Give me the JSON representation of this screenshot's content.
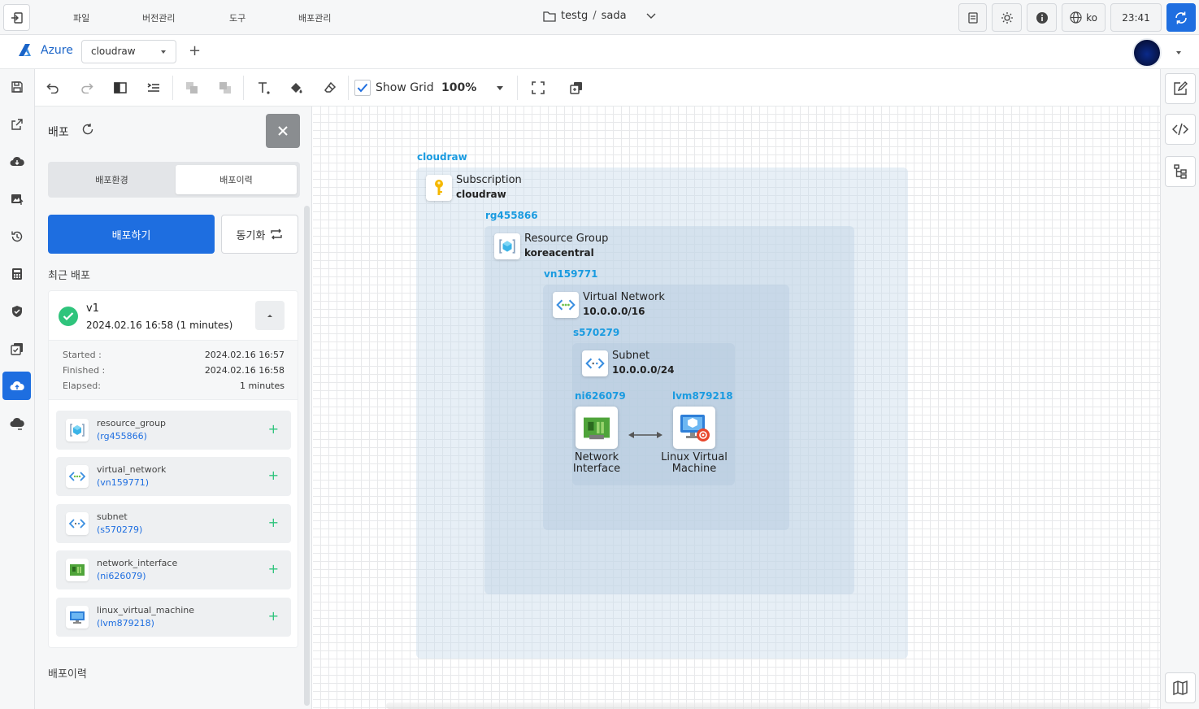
{
  "menu": {
    "items": [
      "파일",
      "버전관리",
      "도구",
      "배포관리"
    ]
  },
  "project": {
    "workspace": "testg",
    "separator": "/",
    "name": "sada"
  },
  "topbar": {
    "language": "ko",
    "time": "23:41"
  },
  "bar2": {
    "brand": "Azure",
    "environment": "cloudraw",
    "add_label": "+"
  },
  "toolbar": {
    "show_grid_label": "Show Grid",
    "show_grid_checked": true,
    "zoom": "100%"
  },
  "panel": {
    "title": "배포",
    "tabs": [
      {
        "label": "배포환경",
        "active": false
      },
      {
        "label": "배포이력",
        "active": true
      }
    ],
    "deploy_button": "배포하기",
    "sync_button": "동기화",
    "recent_label": "최근 배포",
    "history_label": "배포이력",
    "latest": {
      "version": "v1",
      "date": "2024.02.16 16:58",
      "duration": "(1 minutes)",
      "started_label": "Started :",
      "started": "2024.02.16 16:57",
      "finished_label": "Finished :",
      "finished": "2024.02.16 16:58",
      "elapsed_label": "Elapsed:",
      "elapsed": "1 minutes",
      "status_color": "#2fc47c"
    },
    "resources": [
      {
        "type": "resource_group",
        "id": "(rg455866)",
        "icon": "resource-group-icon"
      },
      {
        "type": "virtual_network",
        "id": "(vn159771)",
        "icon": "virtual-network-icon"
      },
      {
        "type": "subnet",
        "id": "(s570279)",
        "icon": "subnet-icon"
      },
      {
        "type": "network_interface",
        "id": "(ni626079)",
        "icon": "network-interface-icon"
      },
      {
        "type": "linux_virtual_machine",
        "id": "(lvm879218)",
        "icon": "linux-vm-icon"
      }
    ],
    "add_symbol": "+"
  },
  "diagram": {
    "subscription": {
      "label": "cloudraw",
      "title": "Subscription",
      "value": "cloudraw"
    },
    "resource_group": {
      "label": "rg455866",
      "title": "Resource Group",
      "value": "koreacentral"
    },
    "vnet": {
      "label": "vn159771",
      "title": "Virtual Network",
      "value": "10.0.0.0/16"
    },
    "subnet": {
      "label": "s570279",
      "title": "Subnet",
      "value": "10.0.0.0/24"
    },
    "nic": {
      "label": "ni626079",
      "title_line1": "Network",
      "title_line2": "Interface"
    },
    "vm": {
      "label": "lvm879218",
      "title_line1": "Linux Virtual",
      "title_line2": "Machine"
    },
    "accent_color": "#1a9be0"
  },
  "colors": {
    "primary": "#1e6ee0",
    "success": "#2fc47c"
  }
}
